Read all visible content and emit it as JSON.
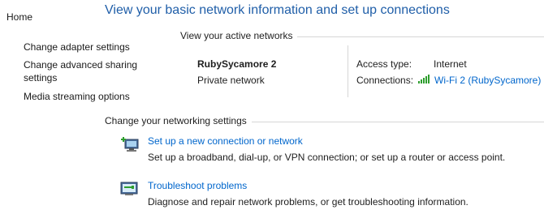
{
  "sidebar": {
    "home": "Home",
    "items": [
      {
        "label": "Change adapter settings"
      },
      {
        "label": "Change advanced sharing"
      },
      {
        "label": "settings"
      },
      {
        "label": "Media streaming options"
      }
    ]
  },
  "header": {
    "title": "View your basic network information and set up connections"
  },
  "active_networks": {
    "section_label": "View your active networks",
    "network_name": "RubySycamore  2",
    "network_type": "Private network",
    "access_type_label": "Access type:",
    "access_type_value": "Internet",
    "connections_label": "Connections:",
    "connection_value": "Wi-Fi 2 (RubySycamore)"
  },
  "settings": {
    "section_label": "Change your networking settings",
    "tasks": [
      {
        "title": "Set up a new connection or network",
        "description": "Set up a broadband, dial-up, or VPN connection; or set up a router or access point.",
        "icon": "new-connection-icon"
      },
      {
        "title": "Troubleshoot problems",
        "description": "Diagnose and repair network problems, or get troubleshooting information.",
        "icon": "troubleshoot-icon"
      }
    ]
  },
  "colors": {
    "title": "#1f5ea8",
    "link": "#0066cc",
    "divider": "#d6d6d6",
    "signal": "#2e9e2e"
  }
}
